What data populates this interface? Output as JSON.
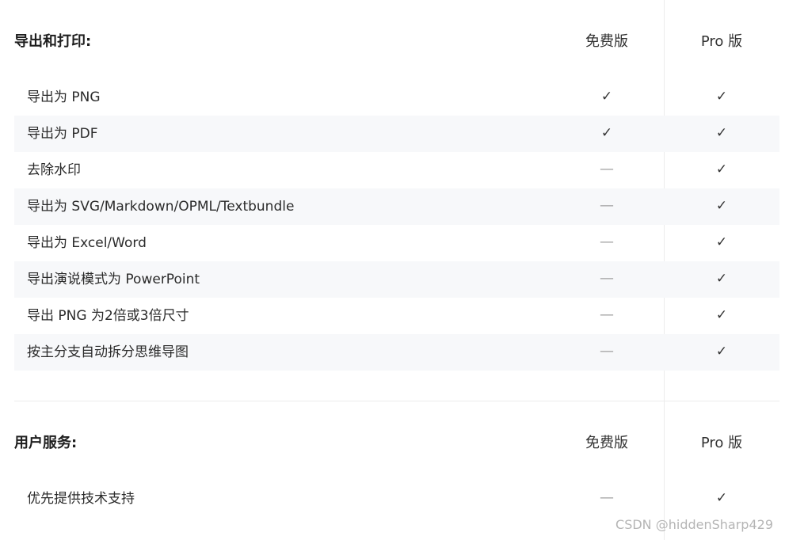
{
  "sections": [
    {
      "title": "导出和打印:",
      "col_free": "免费版",
      "col_pro": "Pro 版",
      "rows": [
        {
          "label": "导出为 PNG",
          "free": "✓",
          "pro": "✓"
        },
        {
          "label": "导出为 PDF",
          "free": "✓",
          "pro": "✓"
        },
        {
          "label": "去除水印",
          "free": "—",
          "pro": "✓"
        },
        {
          "label": "导出为 SVG/Markdown/OPML/Textbundle",
          "free": "—",
          "pro": "✓"
        },
        {
          "label": "导出为 Excel/Word",
          "free": "—",
          "pro": "✓"
        },
        {
          "label": "导出演说模式为 PowerPoint",
          "free": "—",
          "pro": "✓"
        },
        {
          "label": "导出 PNG 为2倍或3倍尺寸",
          "free": "—",
          "pro": "✓"
        },
        {
          "label": "按主分支自动拆分思维导图",
          "free": "—",
          "pro": "✓"
        }
      ]
    },
    {
      "title": "用户服务:",
      "col_free": "免费版",
      "col_pro": "Pro 版",
      "rows": [
        {
          "label": "优先提供技术支持",
          "free": "—",
          "pro": "✓"
        }
      ]
    }
  ],
  "icons": {
    "included": "check-icon",
    "excluded": "dash-icon"
  },
  "colors": {
    "stripe": "#f7f8fa",
    "divider": "#ececec",
    "text": "#222222",
    "dash": "#a0a0a0"
  },
  "watermark": "CSDN @hiddenSharp429"
}
